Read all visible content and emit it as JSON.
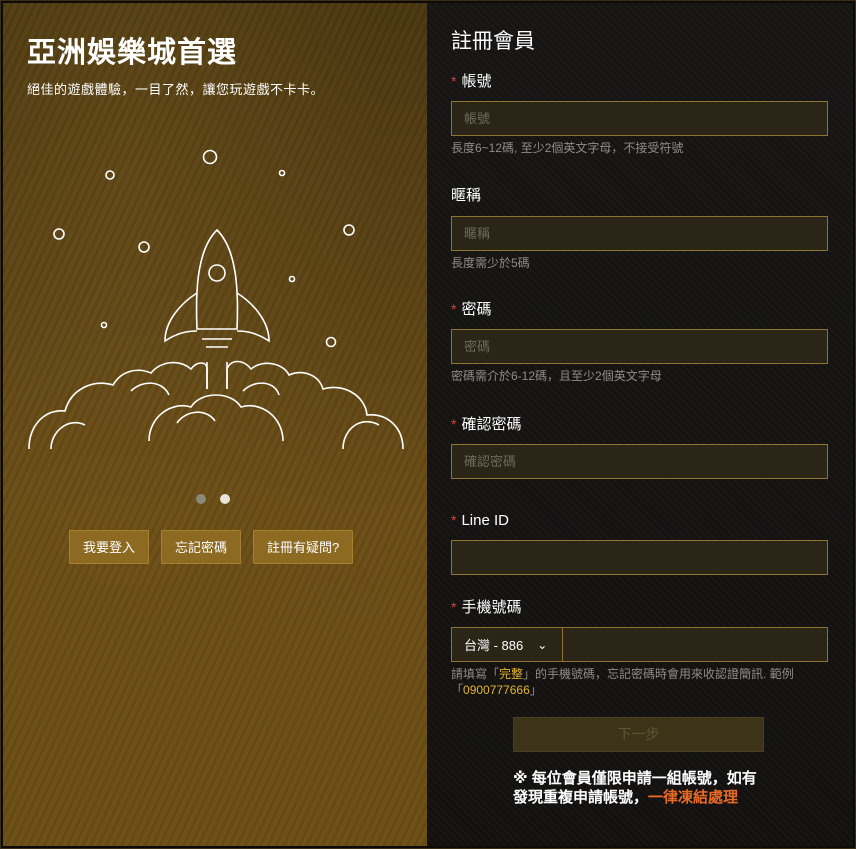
{
  "left": {
    "title": "亞洲娛樂城首選",
    "subtitle": "絕佳的遊戲體驗，一目了然，讓您玩遊戲不卡卡。",
    "carousel": {
      "count": 2,
      "active_index": 1
    },
    "buttons": {
      "login": "我要登入",
      "forgot": "忘記密碼",
      "help": "註冊有疑問?"
    }
  },
  "form": {
    "title": "註冊會員",
    "required_mark": "*",
    "account": {
      "label": "帳號",
      "placeholder": "帳號",
      "hint": "長度6~12碼, 至少2個英文字母，不接受符號",
      "required": true
    },
    "nickname": {
      "label": "暱稱",
      "placeholder": "暱稱",
      "hint": "長度需少於5碼",
      "required": false
    },
    "password": {
      "label": "密碼",
      "placeholder": "密碼",
      "hint": "密碼需介於6-12碼，且至少2個英文字母",
      "required": true
    },
    "confirm": {
      "label": "確認密碼",
      "placeholder": "確認密碼",
      "required": true
    },
    "line": {
      "label": "Line ID",
      "placeholder": "",
      "required": true
    },
    "phone": {
      "label": "手機號碼",
      "required": true,
      "country_selected": "台灣 - 886",
      "hint_prefix": "請填寫「",
      "hint_bold": "完整",
      "hint_mid": "」的手機號碼，忘記密碼時會用來收認證簡訊. 範例「",
      "hint_example": "0900777666",
      "hint_suffix": "」"
    },
    "submit_label": "下一步",
    "notice_prefix": "※ 每位會員僅限申請一組帳號，如有發現重複申請帳號，",
    "notice_highlight": "一律凍結處理"
  },
  "colors": {
    "accent_gold": "#8c6a22",
    "required": "#d8423a",
    "highlight_orange": "#e96a25",
    "hint_gold": "#e3b52a"
  }
}
